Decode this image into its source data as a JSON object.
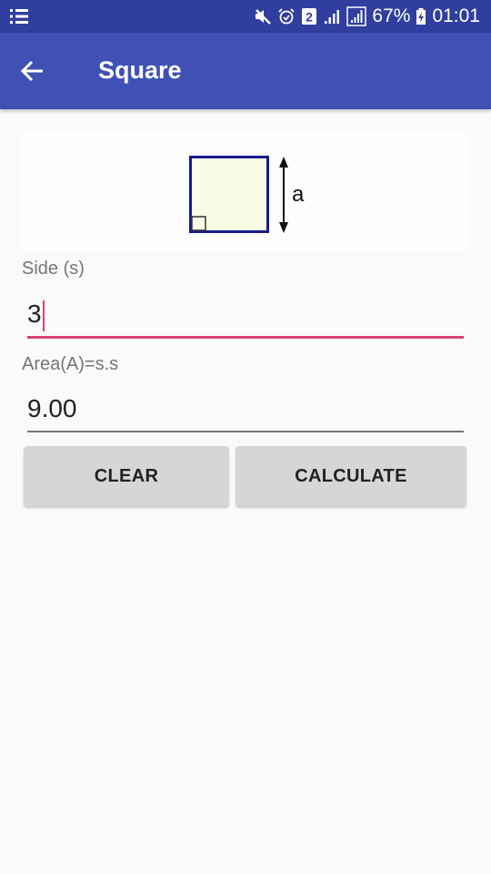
{
  "status_bar": {
    "left_icon": "notification-list-icon",
    "icons": [
      "mute-icon",
      "alarm-icon",
      "sim-2-icon",
      "signal-icon",
      "signal-boxed-icon",
      "battery-charging-icon"
    ],
    "sim_label": "2",
    "battery": "67%",
    "time": "01:01"
  },
  "app_bar": {
    "back_icon": "arrow-back-icon",
    "title": "Square"
  },
  "figure": {
    "side_label": "a",
    "fill_color": "#fafde6",
    "stroke_color": "#1a1a8c"
  },
  "form": {
    "side": {
      "label": "Side (s)",
      "value": "3"
    },
    "area": {
      "label": "Area(A)=s.s",
      "value": "9.00"
    }
  },
  "buttons": {
    "clear": "CLEAR",
    "calculate": "CALCULATE"
  },
  "colors": {
    "status_bar": "#303f9f",
    "app_bar": "#3f51b5",
    "accent": "#d6437a"
  }
}
